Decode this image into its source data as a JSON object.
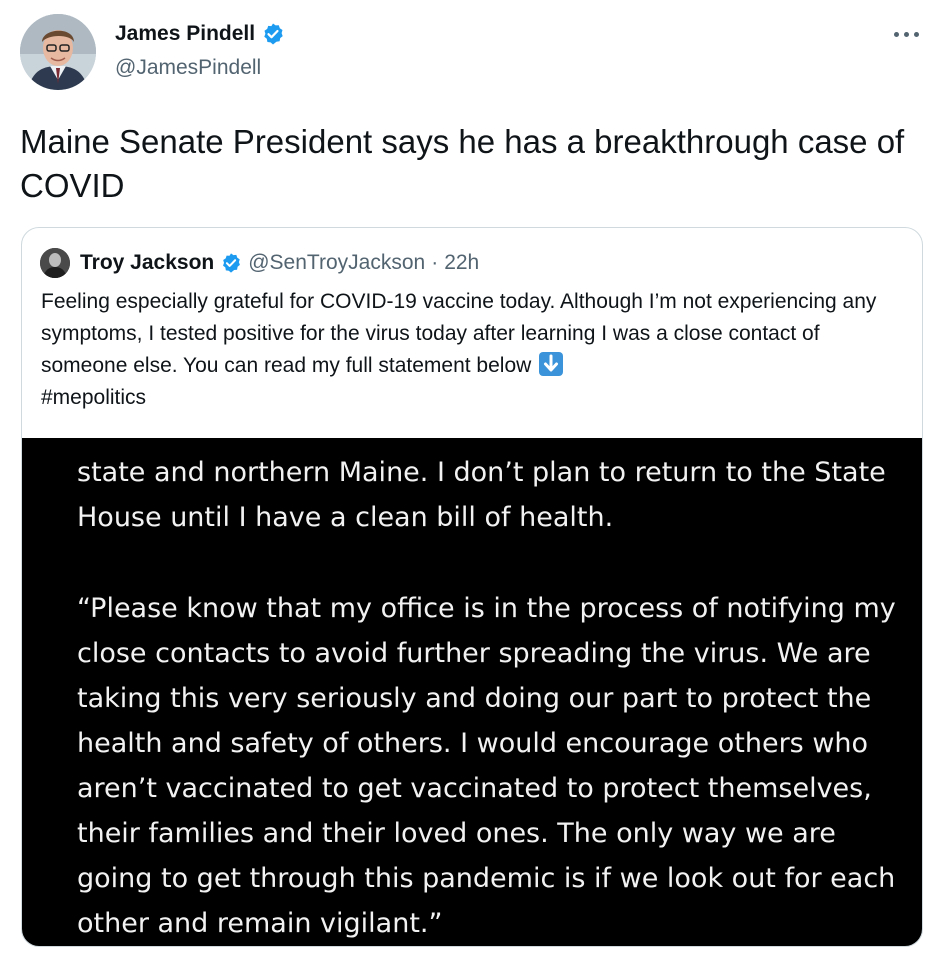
{
  "author": {
    "name": "James Pindell",
    "handle": "@JamesPindell"
  },
  "tweet": {
    "text": "Maine Senate President says he has a breakthrough case of COVID"
  },
  "quoted_tweet": {
    "name": "Troy Jackson",
    "handle": "@SenTroyJackson",
    "separator": "·",
    "time": "22h",
    "text": "Feeling especially grateful for COVID-19 vaccine today. Although I’m not experiencing any symptoms, I tested positive for the virus today after learning I was a close contact of someone else. You can read my full statement below",
    "hashtag": "#mepolitics",
    "image_lines": [
      "state and northern Maine. I don’t plan to return to the State",
      "House until I have a clean bill of health.",
      "“Please know that my office is in the process of notifying my",
      "close contacts to avoid further spreading the virus. We are",
      "taking this very seriously and doing our part to protect the",
      "health and safety of others. I would encourage others who",
      "aren’t vaccinated to get vaccinated to protect themselves,",
      "their families and their loved ones. The only way we are",
      "going to get through this pandemic is if we look out for each",
      "other and remain vigilant.”"
    ]
  },
  "icons": {
    "verified": "verified-badge-icon",
    "more": "more-options-icon",
    "emoji": "down-arrow-emoji-icon"
  },
  "colors": {
    "verified": "#1d9bf0",
    "secondary_text": "#536471",
    "image_background": "#000000",
    "emoji_blue": "#3b94d9"
  }
}
